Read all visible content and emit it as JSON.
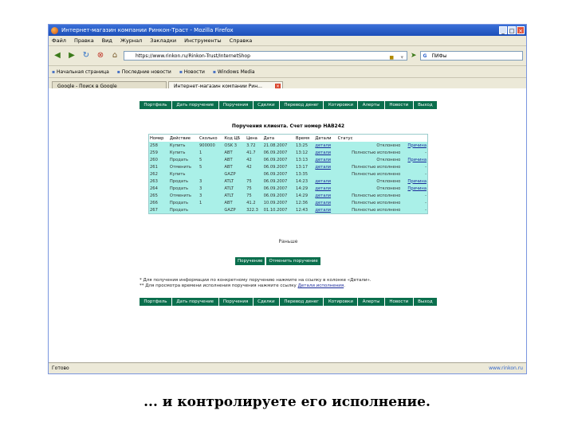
{
  "window": {
    "title": "Интернет-магазин компании Ринкон-Траст - Mozilla Firefox"
  },
  "menu": [
    "Файл",
    "Правка",
    "Вид",
    "Журнал",
    "Закладки",
    "Инструменты",
    "Справка"
  ],
  "nav": {
    "url": "https://www.rinkon.ru/Rinkon-Trust/InternetShop",
    "search_value": "ПИФы"
  },
  "bookmarks": [
    "Начальная страница",
    "Последние новости",
    "Новости",
    "Windows Media"
  ],
  "tabs": [
    {
      "label": "Google - Поиск в Google"
    },
    {
      "label": "Интернет-магазин компании Рин..."
    }
  ],
  "site_nav": [
    "Портфель",
    "Дать поручение",
    "Поручения",
    "Сделки",
    "Перевод денег",
    "Котировки",
    "Алерты",
    "Новости",
    "Выход"
  ],
  "page": {
    "heading": "Поручения клиента. Счет номер НАВ242",
    "columns": [
      "Номер",
      "Действие",
      "Сколько",
      "Код ЦБ",
      "Цена",
      "Дата",
      "Время",
      "Детали",
      "Статус",
      ""
    ],
    "rows": [
      {
        "num": "258",
        "action": "Купить",
        "qty": "900000",
        "code": "OSK 3",
        "price": "3.72",
        "date": "21.08.2007",
        "time": "13:25",
        "details": "детали",
        "status": "Отклонено",
        "extra": "Причина"
      },
      {
        "num": "259",
        "action": "Купить",
        "qty": "1",
        "code": "ABT",
        "price": "41.7",
        "date": "06.09.2007",
        "time": "13:12",
        "details": "детали",
        "status": "Полностью исполнено",
        "extra": "-"
      },
      {
        "num": "260",
        "action": "Продать",
        "qty": "5",
        "code": "ABT",
        "price": "42",
        "date": "06.09.2007",
        "time": "13:13",
        "details": "детали",
        "status": "Отклонено",
        "extra": "Причина"
      },
      {
        "num": "261",
        "action": "Отменить",
        "qty": "5",
        "code": "ABT",
        "price": "42",
        "date": "06.09.2007",
        "time": "13:17",
        "details": "детали",
        "status": "Полностью исполнено",
        "extra": "-"
      },
      {
        "num": "262",
        "action": "Купить",
        "qty": "",
        "code": "GAZP",
        "price": "",
        "date": "06.09.2007",
        "time": "13:35",
        "details": "",
        "status": "Полностью исполнено",
        "extra": "-"
      },
      {
        "num": "263",
        "action": "Продать",
        "qty": "3",
        "code": "ATLT",
        "price": "75",
        "date": "06.09.2007",
        "time": "14:23",
        "details": "детали",
        "status": "Отклонено",
        "extra": "Причина"
      },
      {
        "num": "264",
        "action": "Продать",
        "qty": "3",
        "code": "ATLT",
        "price": "75",
        "date": "06.09.2007",
        "time": "14:29",
        "details": "детали",
        "status": "Отклонено",
        "extra": "Причина"
      },
      {
        "num": "265",
        "action": "Отменить",
        "qty": "3",
        "code": "ATLT",
        "price": "75",
        "date": "06.09.2007",
        "time": "14:29",
        "details": "детали",
        "status": "Полностью исполнено",
        "extra": "-"
      },
      {
        "num": "266",
        "action": "Продать",
        "qty": "1",
        "code": "ABT",
        "price": "41.2",
        "date": "10.09.2007",
        "time": "12:36",
        "details": "детали",
        "status": "Полностью исполнено",
        "extra": "-"
      },
      {
        "num": "267",
        "action": "Продать",
        "qty": "",
        "code": "GAZP",
        "price": "322.3",
        "date": "01.10.2007",
        "time": "12:43",
        "details": "детали",
        "status": "Полностью исполнено",
        "extra": "-"
      }
    ],
    "back_label": "Раньше",
    "button_new": "Поручение",
    "button_cancel": "Отменить поручение",
    "note1": "* Для получения информации по конкретному поручению нажмите на ссылку в колонке «Детали».",
    "note2": "** Для просмотра времени исполнения поручения нажмите ссылку",
    "note2_link": "Детали исполнения"
  },
  "status": {
    "text": "Готово",
    "right": "www.rinkon.ru"
  },
  "caption": "... и контролируете его исполнение."
}
